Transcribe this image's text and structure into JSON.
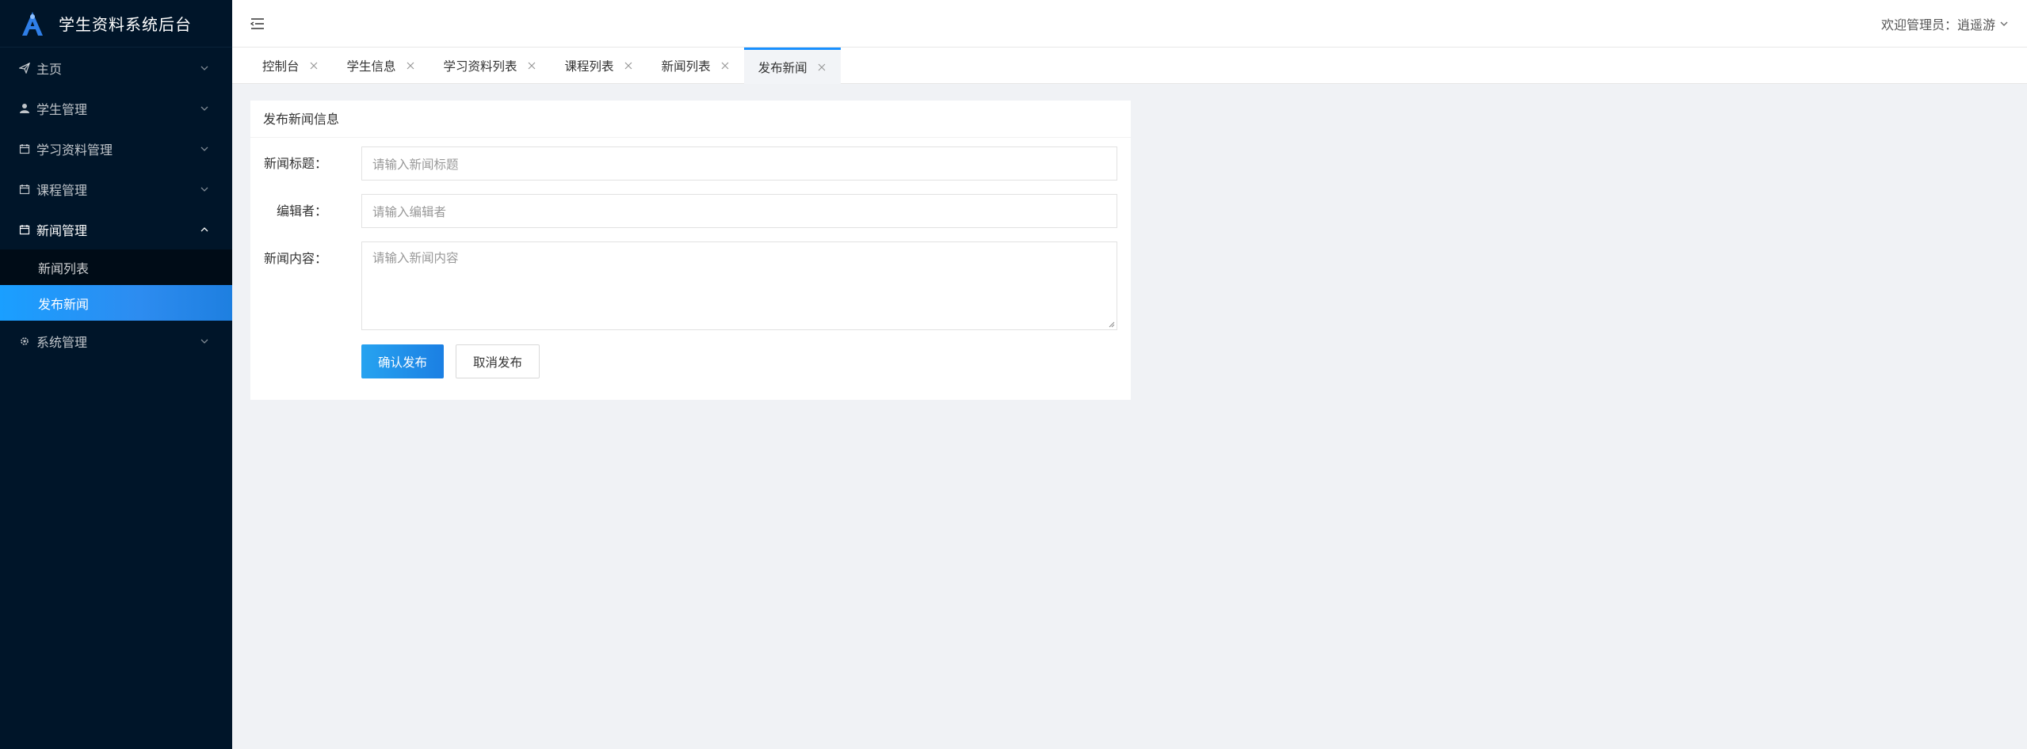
{
  "app": {
    "title": "学生资料系统后台"
  },
  "sidebar": {
    "menu": [
      {
        "label": "主页",
        "icon": "send-icon"
      },
      {
        "label": "学生管理",
        "icon": "user-icon"
      },
      {
        "label": "学习资料管理",
        "icon": "calendar-icon"
      },
      {
        "label": "课程管理",
        "icon": "calendar-icon"
      },
      {
        "label": "新闻管理",
        "icon": "calendar-icon",
        "open": true,
        "children": [
          {
            "label": "新闻列表"
          },
          {
            "label": "发布新闻",
            "active": true
          }
        ]
      },
      {
        "label": "系统管理",
        "icon": "gear-icon"
      }
    ]
  },
  "header": {
    "user_greeting": "欢迎管理员：逍遥游"
  },
  "tabs": [
    {
      "label": "控制台"
    },
    {
      "label": "学生信息"
    },
    {
      "label": "学习资料列表"
    },
    {
      "label": "课程列表"
    },
    {
      "label": "新闻列表"
    },
    {
      "label": "发布新闻",
      "active": true
    }
  ],
  "form": {
    "card_title": "发布新闻信息",
    "title_label": "新闻标题：",
    "title_placeholder": "请输入新闻标题",
    "editor_label": "编辑者：",
    "editor_placeholder": "请输入编辑者",
    "content_label": "新闻内容：",
    "content_placeholder": "请输入新闻内容",
    "submit_label": "确认发布",
    "cancel_label": "取消发布"
  },
  "colors": {
    "sidebar_bg": "#001529",
    "accent": "#1890ff",
    "active_item": "#2d8cf0",
    "page_bg": "#f0f2f5"
  }
}
